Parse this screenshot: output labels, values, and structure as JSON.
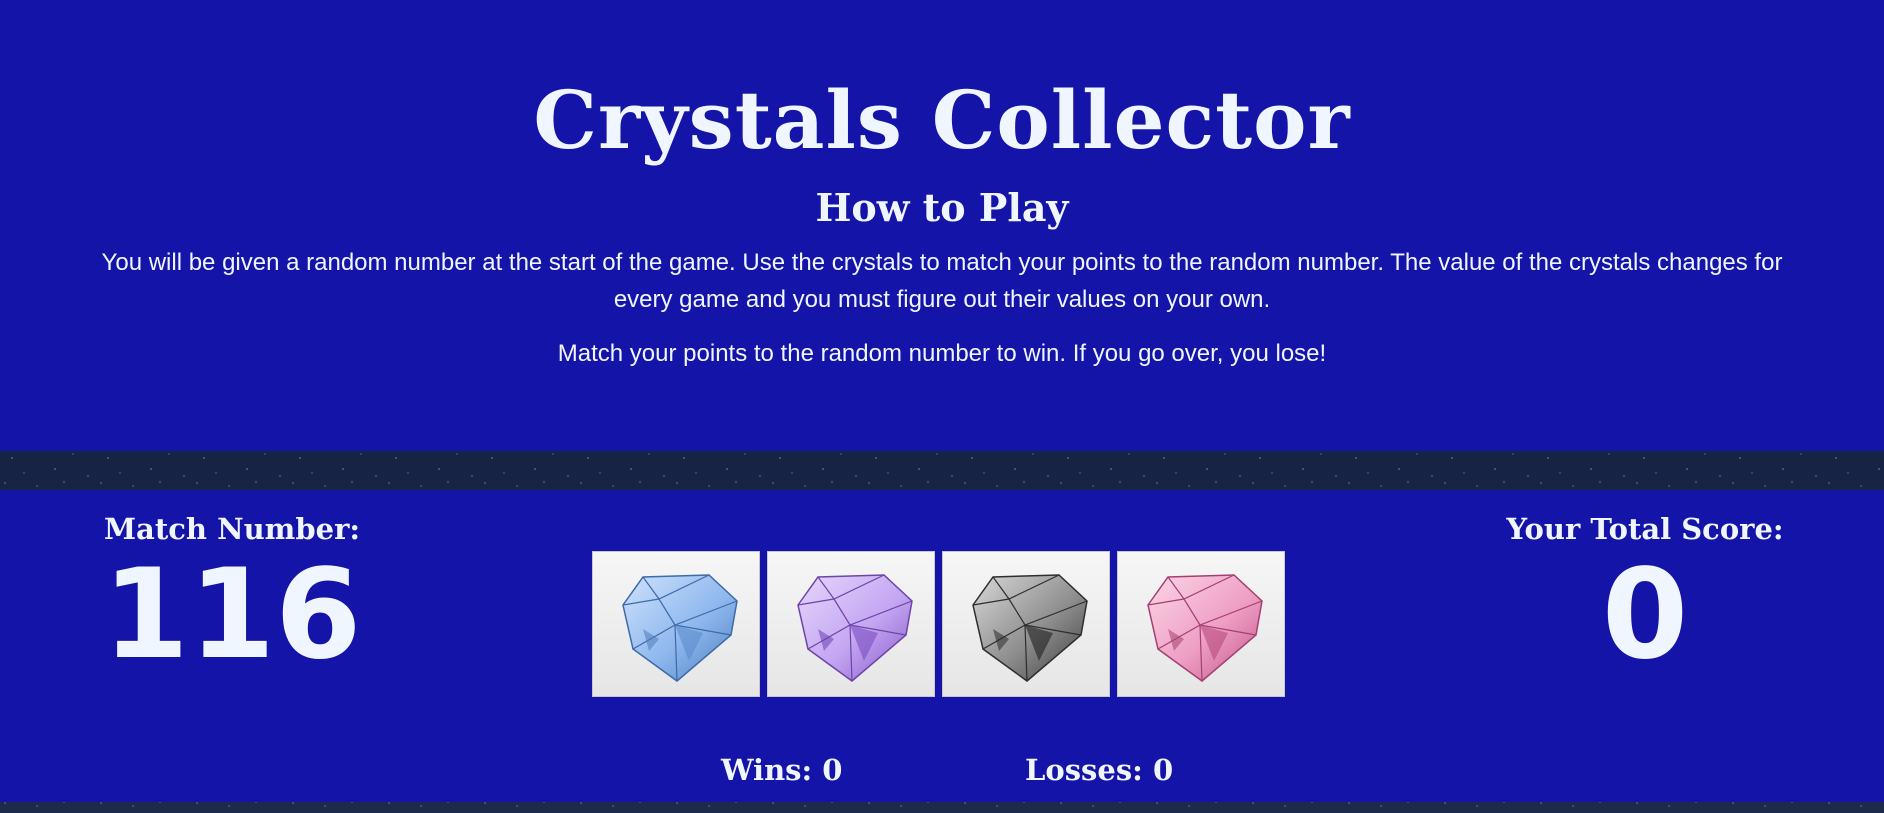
{
  "header": {
    "title": "Crystals Collector",
    "how_to_play_heading": "How to Play",
    "instructions": "You will be given a random number at the start of the game. Use the crystals to match your points to the random number. The value of the crystals changes for every game and you must figure out their values on your own.",
    "win_rule": "Match your points to the random number to win. If you go over, you lose!"
  },
  "game": {
    "match_label": "Match Number:",
    "match_value": "116",
    "score_label": "Your Total Score:",
    "score_value": "0",
    "wins_text": "Wins: 0",
    "losses_text": "Losses: 0",
    "crystals": [
      {
        "icon": "blue-crystal-icon",
        "color": "#8fb8ee"
      },
      {
        "icon": "purple-crystal-icon",
        "color": "#c4a6f2"
      },
      {
        "icon": "gray-crystal-icon",
        "color": "#8e8e8e"
      },
      {
        "icon": "pink-crystal-icon",
        "color": "#ee9fc4"
      }
    ]
  },
  "colors": {
    "panel": "#1414a8",
    "text": "#f0f6ff"
  }
}
